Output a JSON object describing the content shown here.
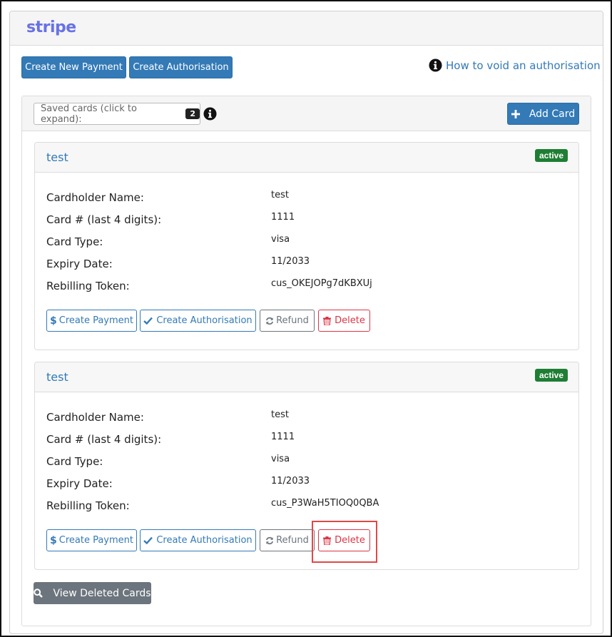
{
  "brand": {
    "name": "stripe"
  },
  "toolbar": {
    "create_payment": "Create New Payment",
    "create_authorisation": "Create Authorisation",
    "help_link": "How to void an authorisation"
  },
  "saved_cards": {
    "toggle_label": "Saved cards (click to expand):",
    "count": "2",
    "add_card": "Add Card"
  },
  "field_labels": {
    "cardholder": "Cardholder Name:",
    "card_number": "Card # (last 4 digits):",
    "card_type": "Card Type:",
    "expiry": "Expiry Date:",
    "token": "Rebilling Token:"
  },
  "cards": [
    {
      "title": "test",
      "status": "active",
      "cardholder": "test",
      "card_number": "1111",
      "card_type": "visa",
      "expiry": "11/2033",
      "token": "cus_OKEJOPg7dKBXUj"
    },
    {
      "title": "test",
      "status": "active",
      "cardholder": "test",
      "card_number": "1111",
      "card_type": "visa",
      "expiry": "11/2033",
      "token": "cus_P3WaH5TIOQ0QBA"
    }
  ],
  "card_actions": {
    "create_payment": "Create Payment",
    "create_authorisation": "Create Authorisation",
    "refund": "Refund",
    "delete": "Delete"
  },
  "footer": {
    "view_deleted": "View Deleted Cards"
  },
  "colors": {
    "primary": "#337ab7",
    "danger": "#dc3545",
    "success": "#1e7e34",
    "secondary": "#6c757d",
    "brand": "#6772e5",
    "highlight": "#e04848"
  },
  "icons": {
    "help": "info-circle-icon",
    "add": "plus-icon",
    "payment": "dollar-icon",
    "authorise": "check-icon",
    "refund": "refresh-icon",
    "delete": "trash-icon",
    "view_deleted": "search-icon"
  }
}
